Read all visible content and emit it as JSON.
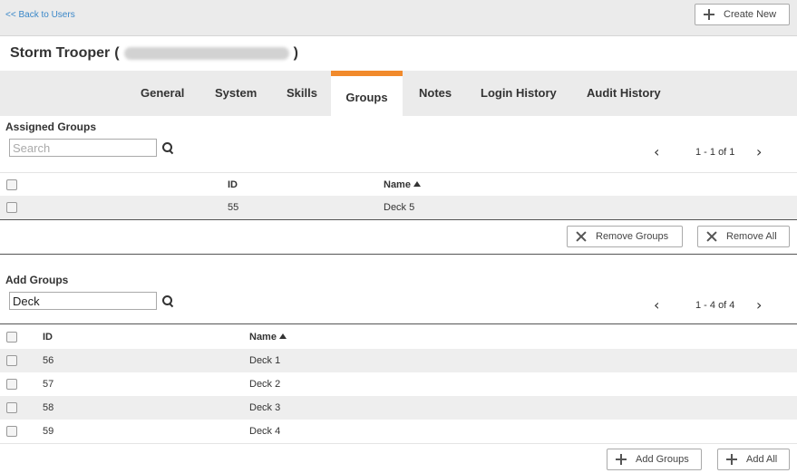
{
  "header": {
    "back_link": "<< Back to Users",
    "create_label": "Create New",
    "user_name": "Storm Trooper",
    "paren_open": "(",
    "paren_close": ")"
  },
  "tabs": [
    {
      "label": "General"
    },
    {
      "label": "System"
    },
    {
      "label": "Skills"
    },
    {
      "label": "Groups"
    },
    {
      "label": "Notes"
    },
    {
      "label": "Login History"
    },
    {
      "label": "Audit History"
    }
  ],
  "active_tab": "Groups",
  "assigned": {
    "title": "Assigned Groups",
    "search_placeholder": "Search",
    "search_value": "",
    "page_info": "1 - 1 of 1",
    "columns": {
      "id": "ID",
      "name": "Name"
    },
    "rows": [
      {
        "id": "55",
        "name": "Deck 5"
      }
    ],
    "remove_groups_label": "Remove Groups",
    "remove_all_label": "Remove All"
  },
  "add": {
    "title": "Add Groups",
    "search_placeholder": "",
    "search_value": "Deck",
    "page_info": "1 - 4 of 4",
    "columns": {
      "id": "ID",
      "name": "Name"
    },
    "rows": [
      {
        "id": "56",
        "name": "Deck 1"
      },
      {
        "id": "57",
        "name": "Deck 2"
      },
      {
        "id": "58",
        "name": "Deck 3"
      },
      {
        "id": "59",
        "name": "Deck 4"
      }
    ],
    "add_groups_label": "Add Groups",
    "add_all_label": "Add All"
  },
  "colors": {
    "accent_tab": "#f18a2c",
    "link": "#3a87c8",
    "row_alt": "#eeeeee"
  }
}
